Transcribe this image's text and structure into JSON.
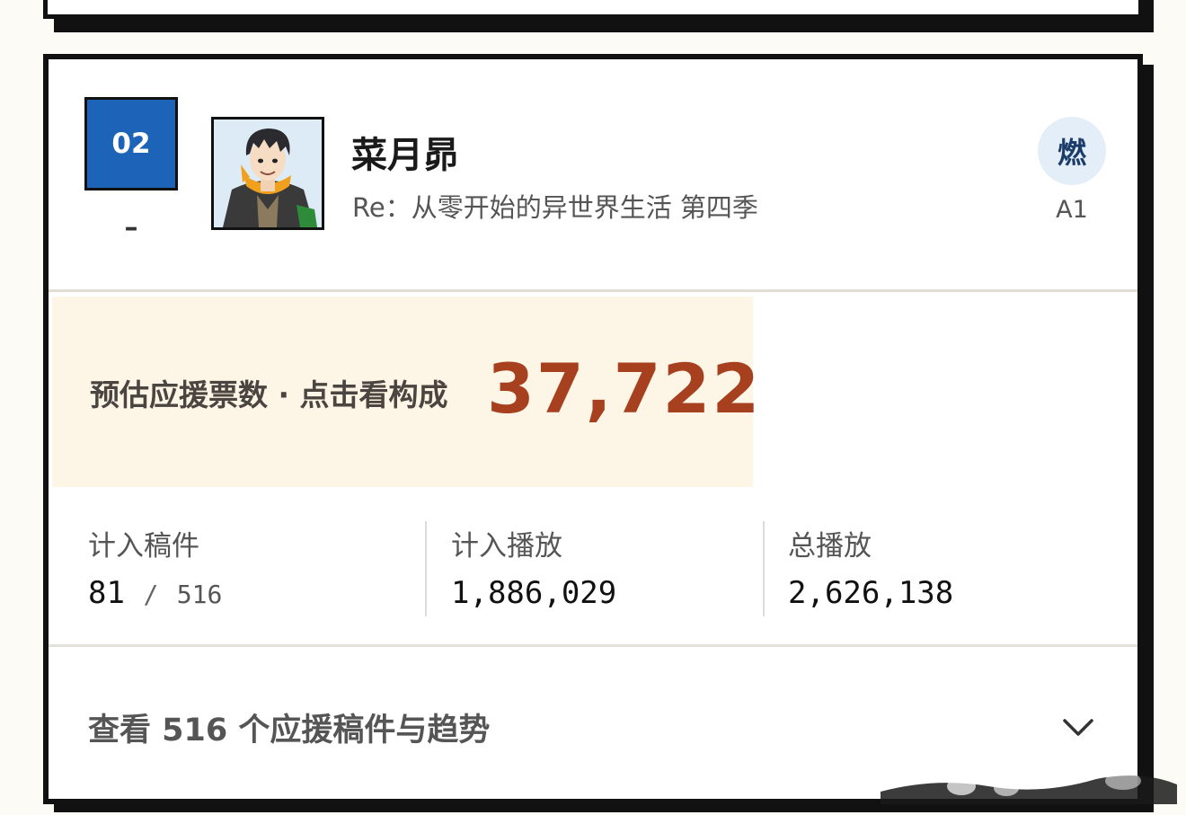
{
  "rank": {
    "number": "02",
    "change": "–"
  },
  "character": {
    "name": "菜月昴",
    "series": "Re：从零开始的异世界生活 第四季"
  },
  "badge": {
    "glyph": "燃",
    "code": "A1"
  },
  "estimate": {
    "label": "预估应援票数 · 点击看构成",
    "value": "37,722"
  },
  "stats": {
    "counted_works": {
      "label": "计入稿件",
      "value": "81",
      "separator": "/",
      "total": "516"
    },
    "counted_plays": {
      "label": "计入播放",
      "value": "1,886,029"
    },
    "total_plays": {
      "label": "总播放",
      "value": "2,626,138"
    }
  },
  "expand": {
    "label": "查看 516 个应援稿件与趋势",
    "icon": "chevron-down-icon"
  },
  "colors": {
    "rank_box": "#1d64b8",
    "estimate_bg": "#fdf5e5",
    "estimate_value": "#a6401e",
    "badge_bg": "#e4eef8"
  }
}
